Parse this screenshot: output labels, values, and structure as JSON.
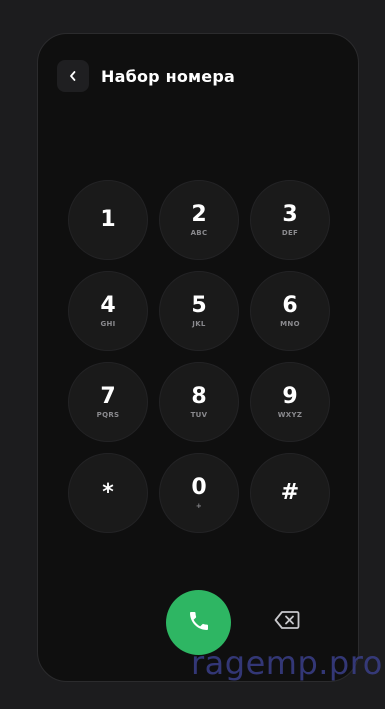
{
  "header": {
    "title": "Набор номера",
    "back_icon": "chevron-left-icon"
  },
  "keypad": {
    "keys": [
      {
        "digit": "1",
        "letters": ""
      },
      {
        "digit": "2",
        "letters": "ABC"
      },
      {
        "digit": "3",
        "letters": "DEF"
      },
      {
        "digit": "4",
        "letters": "GHI"
      },
      {
        "digit": "5",
        "letters": "JKL"
      },
      {
        "digit": "6",
        "letters": "MNO"
      },
      {
        "digit": "7",
        "letters": "PQRS"
      },
      {
        "digit": "8",
        "letters": "TUV"
      },
      {
        "digit": "9",
        "letters": "WXYZ"
      },
      {
        "digit": "*",
        "letters": ""
      },
      {
        "digit": "0",
        "letters": "+"
      },
      {
        "digit": "#",
        "letters": ""
      }
    ]
  },
  "actions": {
    "call_icon": "phone-icon",
    "delete_icon": "backspace-icon"
  },
  "colors": {
    "background": "#1c1c1e",
    "panel": "#0f0f0f",
    "key": "#1a1a1a",
    "call": "#2eb663",
    "text": "#ffffff",
    "letters": "#8a8a8e"
  },
  "watermark": {
    "text": "ragemp.pro"
  }
}
